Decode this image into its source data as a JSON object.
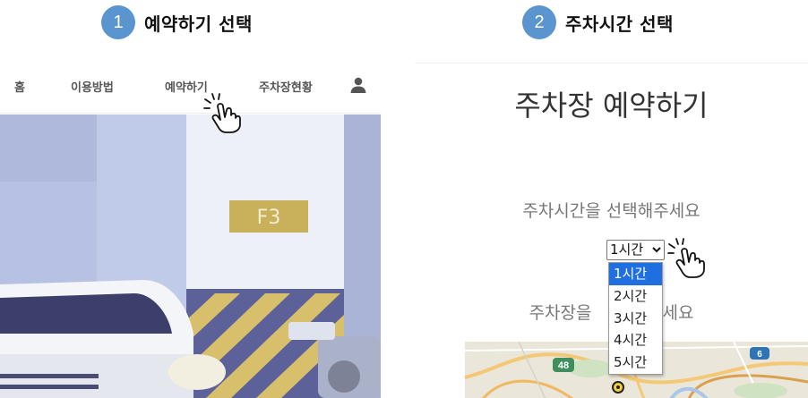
{
  "steps": [
    {
      "number": "1",
      "title": "예약하기 선택"
    },
    {
      "number": "2",
      "title": "주차시간 선택"
    }
  ],
  "left": {
    "nav": {
      "home": "홈",
      "howto": "이용방법",
      "reserve": "예약하기",
      "status": "주차장현황"
    },
    "icons": {
      "user": "user-icon"
    },
    "hero": {
      "sign": "F3"
    }
  },
  "right": {
    "heading": "주차장 예약하기",
    "prompt_time": "주차시간을 선택해주세요",
    "prompt_lot_left": "주차장을",
    "prompt_lot_right": "해주세요",
    "select": {
      "value": "1시간"
    },
    "options": [
      "1시간",
      "2시간",
      "3시간",
      "4시간",
      "5시간"
    ],
    "selected_index": 0,
    "map_badges": {
      "left": "48",
      "right": "6"
    }
  },
  "colors": {
    "badge": "#5b95cf",
    "selected_option": "#1f6fe0",
    "hero_background": "#c3ccea"
  }
}
